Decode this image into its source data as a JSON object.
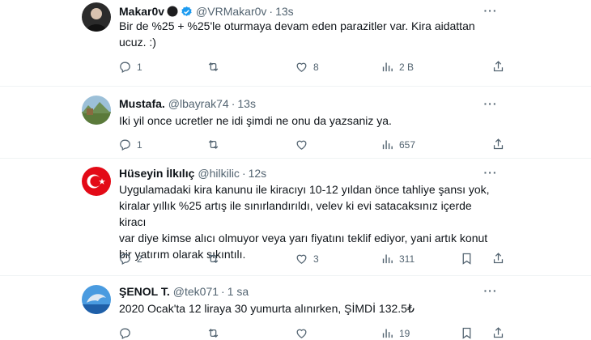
{
  "tweets": [
    {
      "name": "Makar0v",
      "handle": "@VRMakar0v",
      "time": "13s",
      "lines": [
        "Bir de %25 + %25'le oturmaya devam eden parazitler var. Kira aidattan",
        "ucuz. :)"
      ],
      "replies": "1",
      "retweets": "",
      "likes": "8",
      "views": "2 B",
      "badge": "verified-icon"
    },
    {
      "name": "Mustafa.",
      "handle": "@lbayrak74",
      "time": "13s",
      "lines": [
        "Iki yil once ucretler ne idi şimdi ne onu da yazsaniz ya."
      ],
      "replies": "1",
      "retweets": "",
      "likes": "",
      "views": "657"
    },
    {
      "name": "Hüseyin İlkılıç",
      "handle": "@hilkilic",
      "time": "12s",
      "lines": [
        "Uygulamadaki kira kanunu ile kiracıyı 10-12 yıldan önce tahliye şansı yok,",
        "kiralar yıllık %25 artış ile sınırlandırıldı, velev ki evi satacaksınız içerde kiracı",
        "var diye kimse alıcı olmuyor veya yarı fiyatını teklif ediyor, yani  artık konut",
        "bir yatırım olarak sıkıntılı."
      ],
      "replies": "2",
      "retweets": "",
      "likes": "3",
      "views": "311"
    },
    {
      "name": "ŞENOL T.",
      "handle": "@tek071",
      "time": "1 sa",
      "lines": [
        "2020 Ocak'ta 12 liraya 30 yumurta alınırken, ŞİMDİ 132.5₺"
      ],
      "replies": "",
      "retweets": "",
      "likes": "",
      "views": "19"
    }
  ],
  "more_label": "···",
  "dot": "·",
  "colors": {
    "text": "#0f1419",
    "muted": "#536471",
    "divider": "#eff3f4"
  }
}
